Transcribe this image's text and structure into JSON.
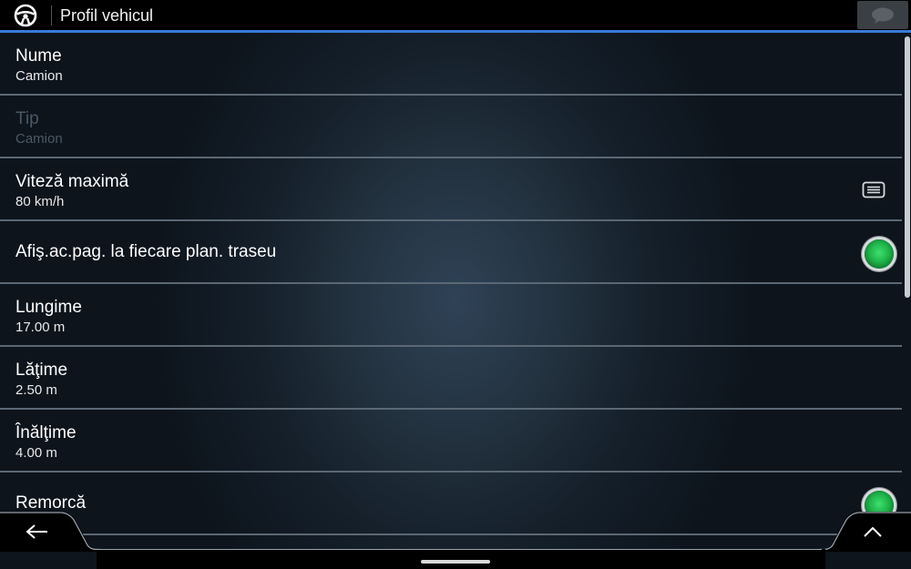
{
  "header": {
    "title": "Profil vehicul",
    "app_icon": "steering-wheel-icon",
    "chat_icon": "chat-bubble-icon"
  },
  "rows": [
    {
      "label": "Nume",
      "value": "Camion",
      "enabled": true
    },
    {
      "label": "Tip",
      "value": "Camion",
      "enabled": false
    },
    {
      "label": "Viteză maximă",
      "value": "80 km/h",
      "enabled": true,
      "icon": "list-icon"
    },
    {
      "label": "Afiş.ac.pag. la fiecare plan. traseu",
      "toggle": true,
      "enabled": true
    },
    {
      "label": "Lungime",
      "value": "17.00 m",
      "enabled": true
    },
    {
      "label": "Lăţime",
      "value": "2.50 m",
      "enabled": true
    },
    {
      "label": "Înălţime",
      "value": "4.00 m",
      "enabled": true
    },
    {
      "label": "Remorcă",
      "toggle": true,
      "enabled": true
    }
  ],
  "footer": {
    "back_icon": "back-arrow-icon",
    "up_icon": "chevron-up-icon"
  },
  "colors": {
    "accent": "#3a7bd5",
    "toggle_on": "#1fb34a",
    "disabled_text": "#4a5866"
  }
}
